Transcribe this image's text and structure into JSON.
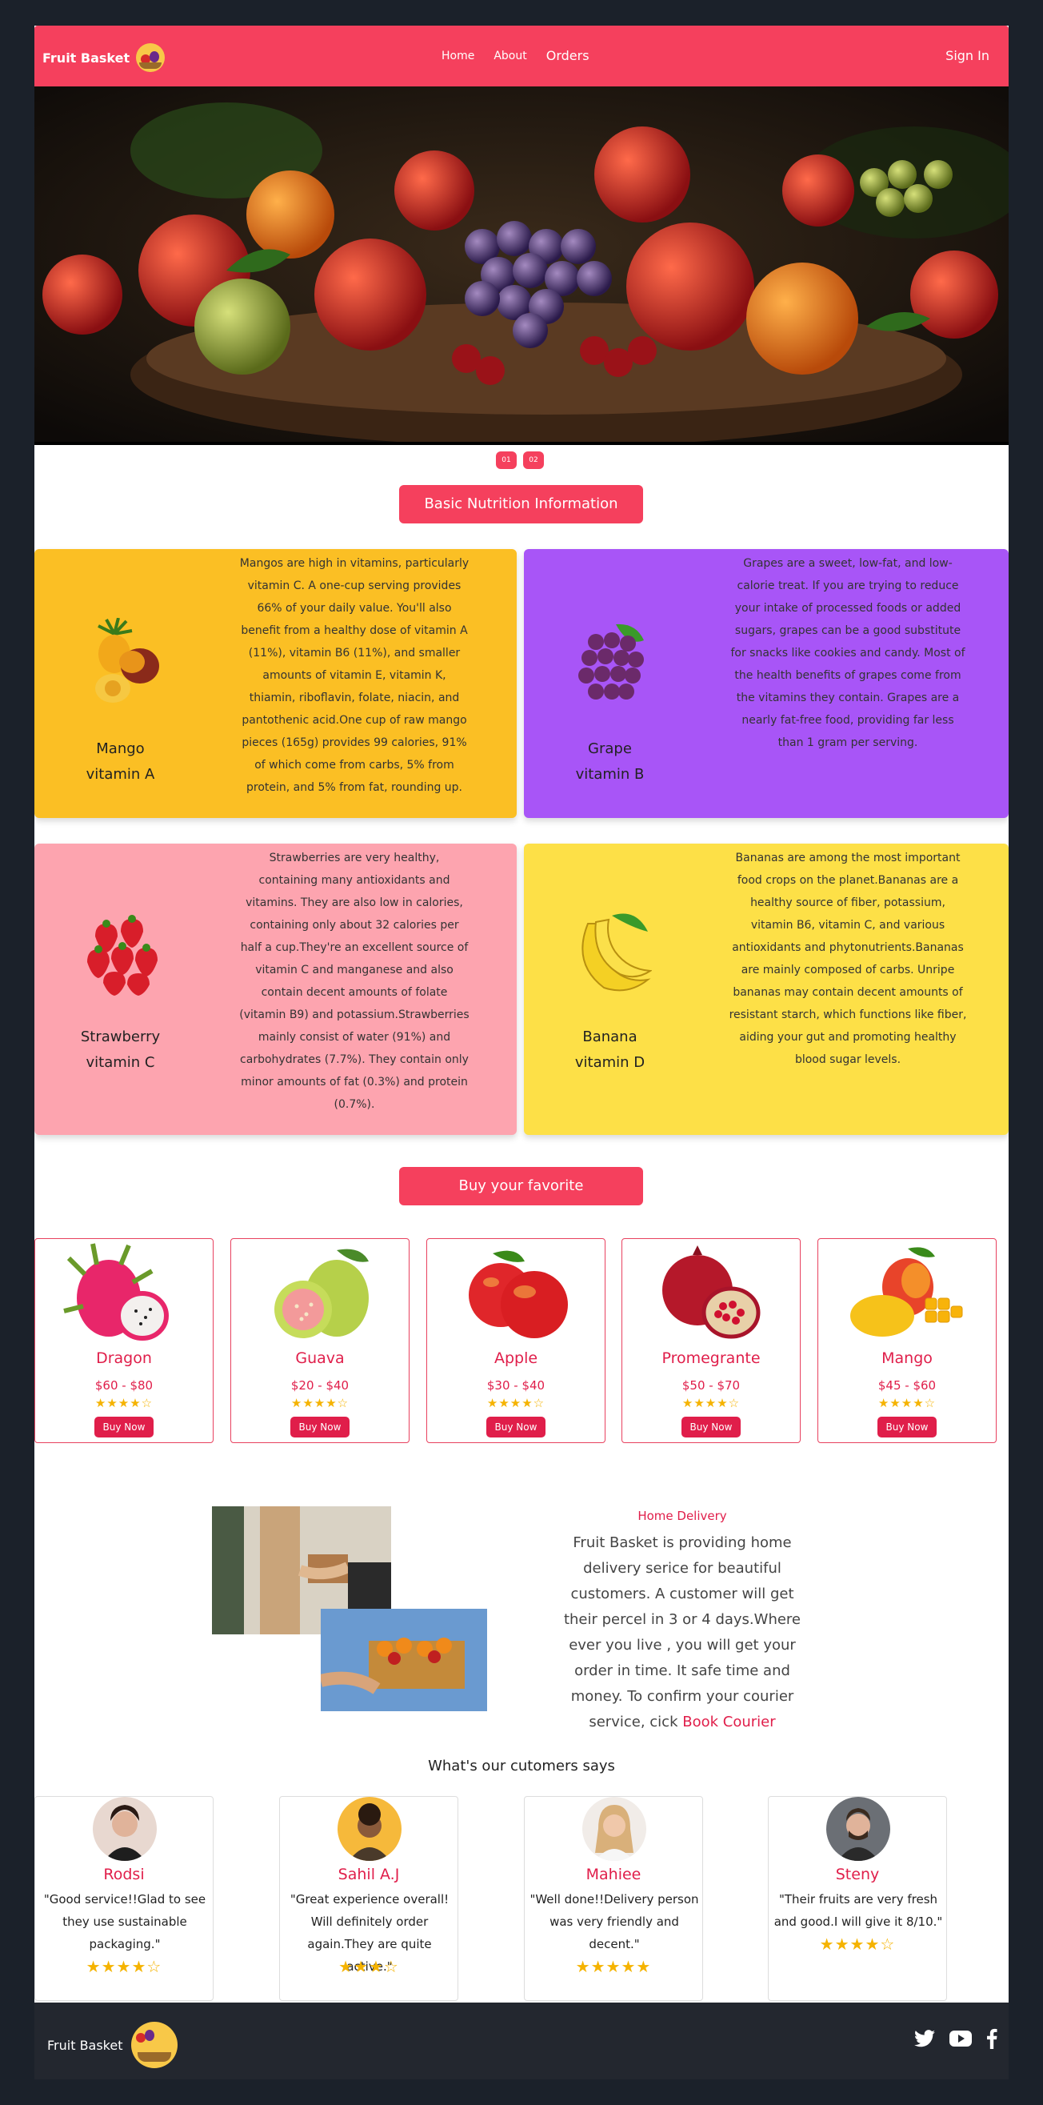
{
  "nav": {
    "brand": "Fruit Basket",
    "links": [
      "Home",
      "About",
      "Orders"
    ],
    "sign_in": "Sign In"
  },
  "carousel": {
    "indicators": [
      "01",
      "02"
    ]
  },
  "nutrition": {
    "heading": "Basic Nutrition Information",
    "cards": [
      {
        "fruit": "Mango",
        "vitamin": "vitamin A",
        "color": "#fbbf24",
        "description": "Mangos are high in vitamins, particularly vitamin C. A one-cup serving provides 66% of your daily value. You'll also benefit from a healthy dose of vitamin A (11%), vitamin B6 (11%), and smaller amounts of vitamin E, vitamin K, thiamin, riboflavin, folate, niacin, and pantothenic acid.One cup of raw mango pieces (165g) provides 99 calories, 91% of which come from carbs, 5% from protein, and 5% from fat, rounding up."
      },
      {
        "fruit": "Grape",
        "vitamin": "vitamin B",
        "color": "#a855f7",
        "description": "Grapes are a sweet, low-fat, and low-calorie treat. If you are trying to reduce your intake of processed foods or added sugars, grapes can be a good substitute for snacks like cookies and candy. Most of the health benefits of grapes come from the vitamins they contain. Grapes are a nearly fat-free food, providing far less than 1 gram per serving."
      },
      {
        "fruit": "Strawberry",
        "vitamin": "vitamin C",
        "color": "#fda4af",
        "description": "Strawberries are very healthy, containing many antioxidants and vitamins. They are also low in calories, containing only about 32 calories per half a cup.They're an excellent source of vitamin C and manganese and also contain decent amounts of folate (vitamin B9) and potassium.Strawberries mainly consist of water (91%) and carbohydrates (7.7%). They contain only minor amounts of fat (0.3%) and protein (0.7%)."
      },
      {
        "fruit": "Banana",
        "vitamin": "vitamin D",
        "color": "#fde047",
        "description": "Bananas are among the most important food crops on the planet.Bananas are a healthy source of fiber, potassium, vitamin B6, vitamin C, and various antioxidants and phytonutrients.Bananas are mainly composed of carbs. Unripe bananas may contain decent amounts of resistant starch, which functions like fiber, aiding your gut and promoting healthy blood sugar levels."
      }
    ]
  },
  "shop": {
    "heading": "Buy your favorite",
    "products": [
      {
        "name": "Dragon",
        "price": "$60 - $80",
        "stars": "★★★★☆",
        "buy": "Buy Now"
      },
      {
        "name": "Guava",
        "price": "$20 - $40",
        "stars": "★★★★☆",
        "buy": "Buy Now"
      },
      {
        "name": "Apple",
        "price": "$30 - $40",
        "stars": "★★★★☆",
        "buy": "Buy Now"
      },
      {
        "name": "Promegrante",
        "price": "$50 - $70",
        "stars": "★★★★☆",
        "buy": "Buy Now"
      },
      {
        "name": "Mango",
        "price": "$45 - $60",
        "stars": "★★★★☆",
        "buy": "Buy Now"
      }
    ]
  },
  "delivery": {
    "heading": "Home Delivery",
    "text": "Fruit Basket is providing home delivery serice for beautiful customers. A customer will get their percel in 3 or 4 days.Where ever you live , you will get your order in time. It safe time and money. To confirm your courier service, cick",
    "link": "Book Courier"
  },
  "reviews": {
    "heading": "What's our cutomers says",
    "items": [
      {
        "name": "Rodsi",
        "quote": "\"Good service!!Glad to see they use sustainable packaging.\"",
        "stars": "★★★★☆",
        "avatar_color": "#e8d8d0"
      },
      {
        "name": "Sahil A.J",
        "quote": "\"Great experience overall! Will definitely order again.They are quite active.\"",
        "stars": "★★★☆",
        "avatar_color": "#f6b93b"
      },
      {
        "name": "Mahiee",
        "quote": "\"Well done!!Delivery person was very friendly and decent.\"",
        "stars": "★★★★★",
        "avatar_color": "#f1ece8"
      },
      {
        "name": "Steny",
        "quote": "\"Their fruits are very fresh and good.I will give it 8/10.\"",
        "stars": "★★★★☆",
        "avatar_color": "#6b6f75"
      }
    ]
  },
  "footer": {
    "brand": "Fruit Basket",
    "social_icons": [
      "twitter-icon",
      "youtube-icon",
      "facebook-icon"
    ]
  }
}
